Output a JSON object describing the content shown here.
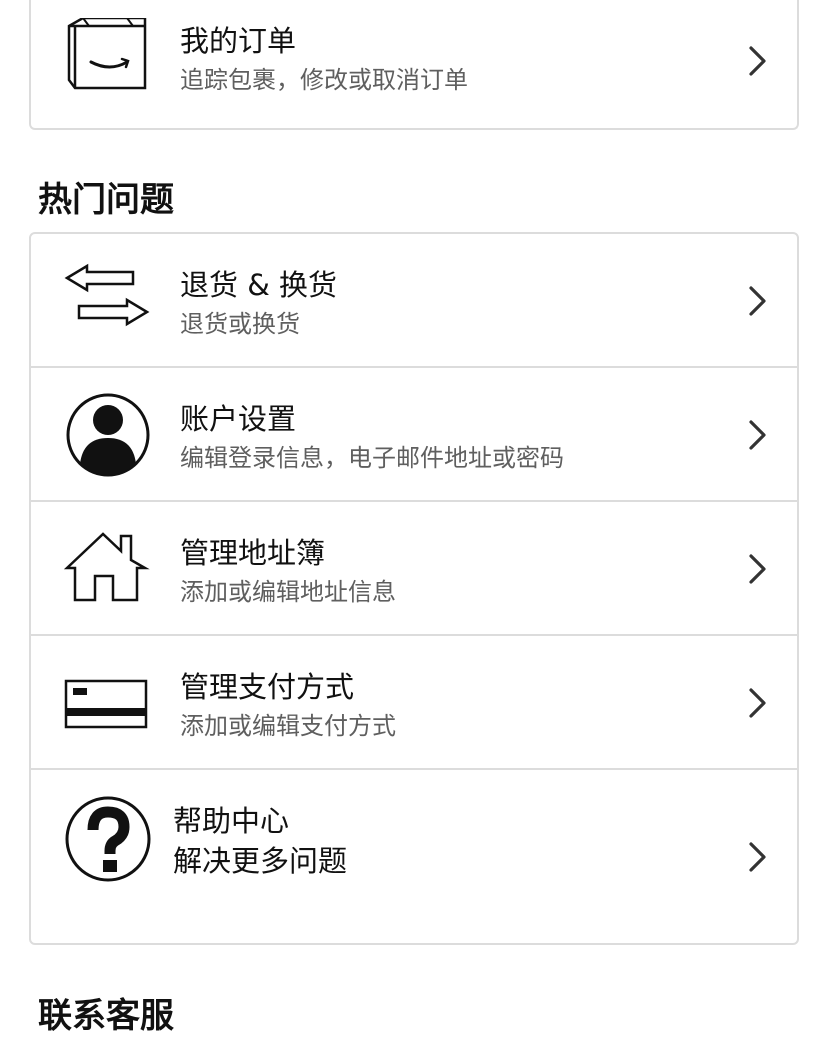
{
  "orders": {
    "title": "我的订单",
    "subtitle": "追踪包裹，修改或取消订单",
    "icon": "package-icon"
  },
  "popular": {
    "heading": "热门问题",
    "items": [
      {
        "title": "退货 & 换货",
        "subtitle": "退货或换货",
        "icon": "exchange-arrows-icon"
      },
      {
        "title": "账户设置",
        "subtitle": "编辑登录信息，电子邮件地址或密码",
        "icon": "user-account-icon"
      },
      {
        "title": "管理地址簿",
        "subtitle": "添加或编辑地址信息",
        "icon": "house-icon"
      },
      {
        "title": "管理支付方式",
        "subtitle": "添加或编辑支付方式",
        "icon": "credit-card-icon"
      },
      {
        "title": "帮助中心",
        "subtitle": "解决更多问题",
        "icon": "question-mark-icon"
      }
    ]
  },
  "contact": {
    "heading": "联系客服"
  }
}
